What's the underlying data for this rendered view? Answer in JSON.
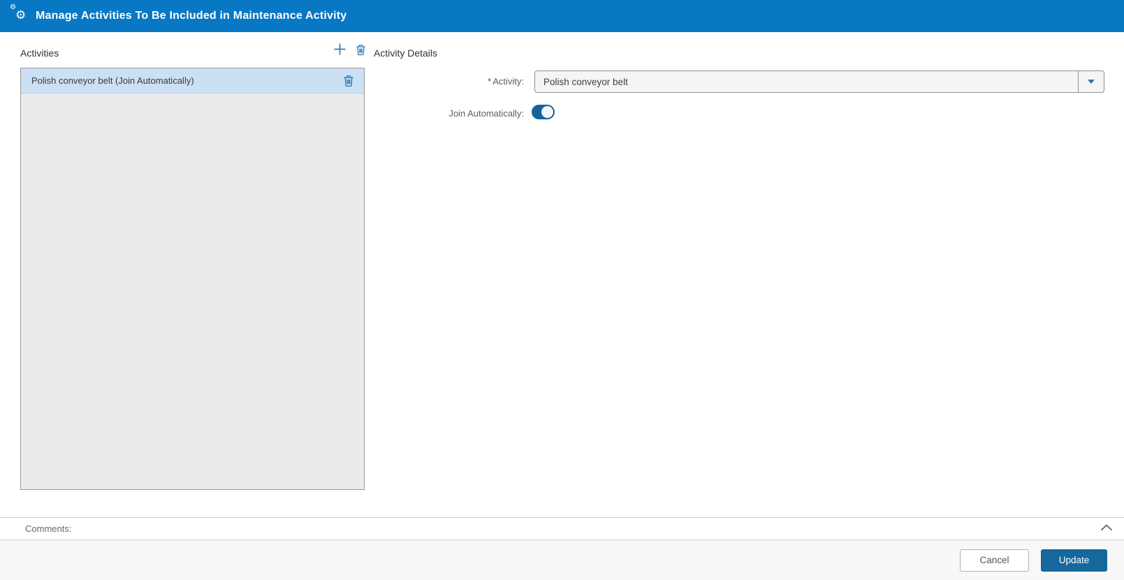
{
  "titlebar": {
    "title": "Manage Activities To Be Included in Maintenance Activity",
    "icon": "cogs-icon"
  },
  "activities_panel": {
    "title": "Activities",
    "toolbar": {
      "add_icon": "plus-icon",
      "delete_icon": "trash-icon"
    },
    "items": [
      {
        "label": "Polish conveyor belt (Join Automatically)",
        "selected": true,
        "row_icon": "trash-icon"
      }
    ]
  },
  "details": {
    "title": "Activity Details",
    "required_marker": "*",
    "activity_label": "Activity:",
    "activity_value": "Polish conveyor belt",
    "join_label": "Join Automatically:",
    "join_value": true
  },
  "comments": {
    "label": "Comments:",
    "state": "expanded-toggle",
    "chevron_icon": "chevron-up-icon"
  },
  "footer": {
    "cancel_label": "Cancel",
    "update_label": "Update"
  },
  "colors": {
    "titlebar_blue": "#0878c4",
    "primary_blue": "#15679c",
    "icon_blue": "#2e7cb8",
    "selected_row_bg": "#cbe1f3",
    "list_bg": "#ebebeb",
    "field_bg": "#f5f5f5",
    "required_red": "#a42f2f",
    "footer_bg": "#f8f8f8"
  }
}
